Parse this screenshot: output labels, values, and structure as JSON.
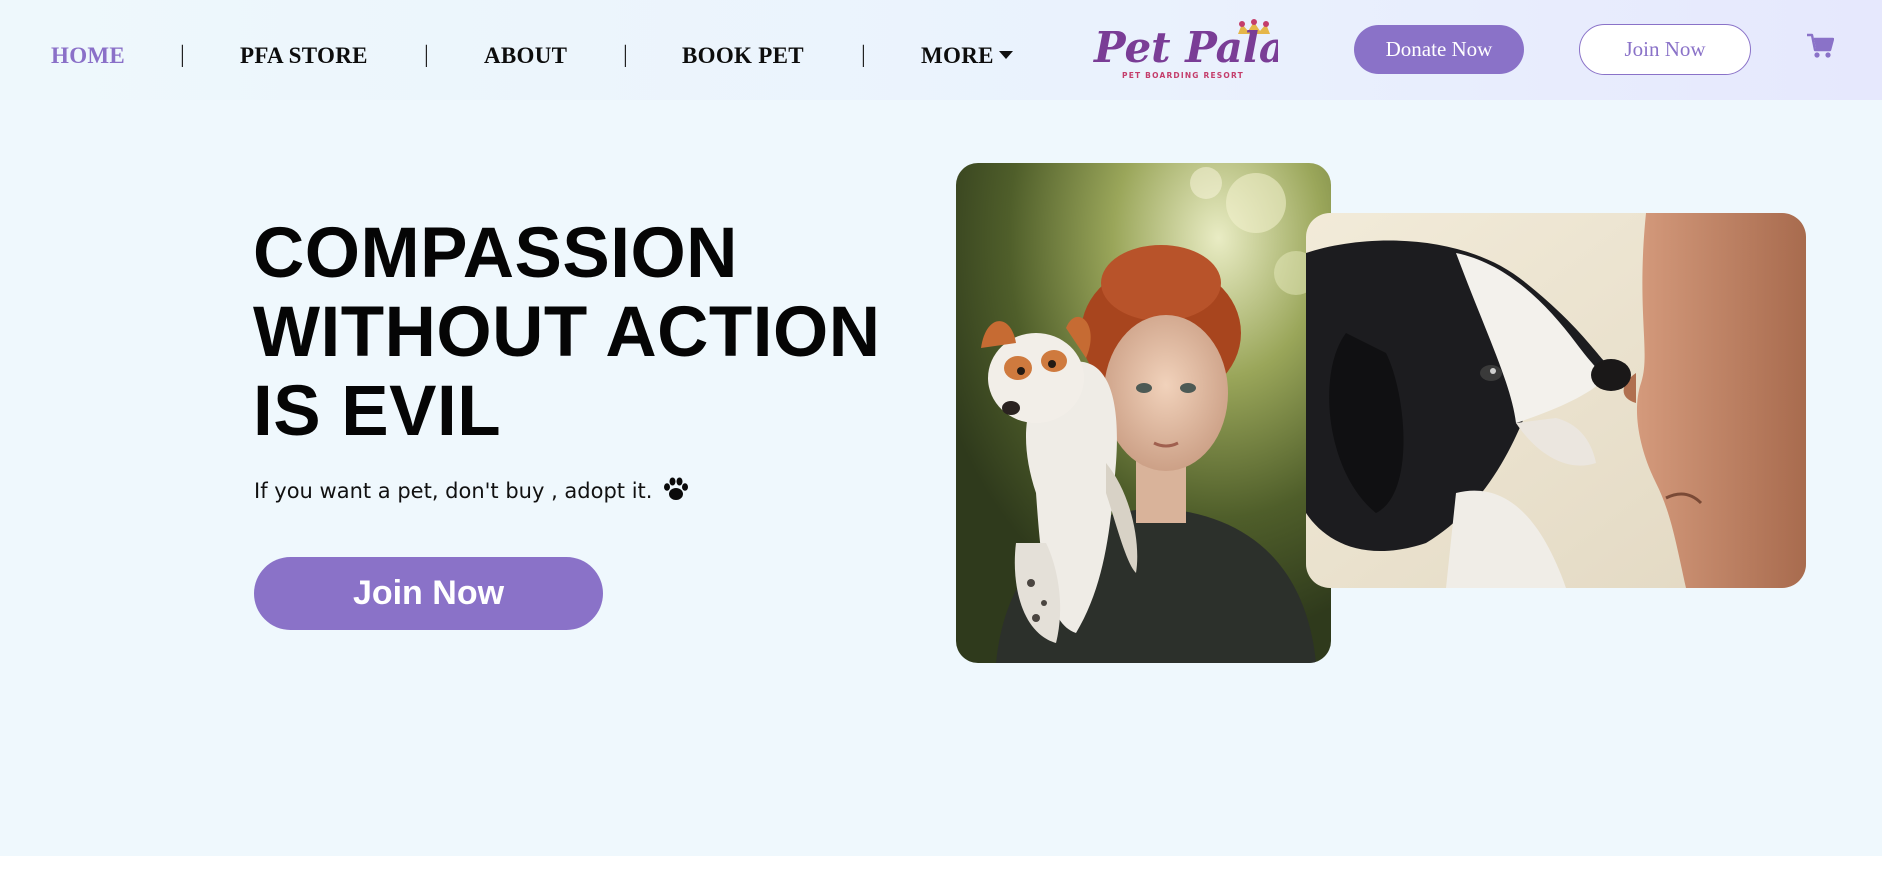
{
  "nav": {
    "items": [
      {
        "label": "HOME",
        "active": true
      },
      {
        "label": "PFA STORE",
        "active": false
      },
      {
        "label": "ABOUT",
        "active": false
      },
      {
        "label": "BOOK PET",
        "active": false
      },
      {
        "label": "MORE",
        "active": false,
        "dropdown": true
      }
    ],
    "separator": "|"
  },
  "brand": {
    "logo_text": "Pet Palace",
    "logo_subtext": "PET BOARDING RESORT"
  },
  "header_actions": {
    "donate_label": "Donate Now",
    "join_label": "Join Now",
    "cart_icon": "shopping-cart-icon"
  },
  "hero": {
    "headline_lines": [
      "COMPASSION",
      "WITHOUT ACTION",
      "IS EVIL"
    ],
    "tagline": "If you want a pet, don't buy , adopt it.",
    "tagline_icon": "paw-icon",
    "cta_label": "Join Now"
  },
  "colors": {
    "accent": "#8a72c8",
    "hero_background": "#eff8fd",
    "headline": "#050505"
  }
}
